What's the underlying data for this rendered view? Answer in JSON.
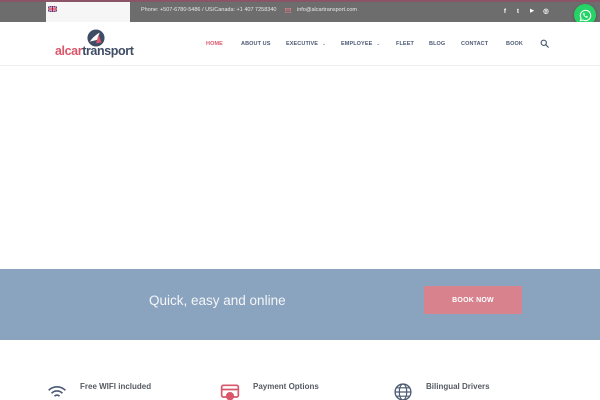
{
  "topbar": {
    "phone": "Phone: +507-6780-5486 / US/Canada: +1 407 7258340",
    "email": "info@alcartransport.com",
    "social": [
      {
        "icon": "facebook-icon",
        "glyph": "f"
      },
      {
        "icon": "twitter-icon",
        "glyph": "t"
      },
      {
        "icon": "youtube-icon",
        "glyph": "▶"
      },
      {
        "icon": "instagram-icon",
        "glyph": "◎"
      }
    ]
  },
  "brand": {
    "part1": "alcar",
    "part2": "transport",
    "accent": "#d9566b",
    "dark": "#3f4c66"
  },
  "nav": {
    "items": [
      {
        "label": "HOME",
        "active": true
      },
      {
        "label": "ABOUT US"
      },
      {
        "label": "EXECUTIVE",
        "has_dropdown": true
      },
      {
        "label": "EMPLOYEE",
        "has_dropdown": true
      },
      {
        "label": "FLEET"
      },
      {
        "label": "BLOG"
      },
      {
        "label": "CONTACT"
      },
      {
        "label": "BOOK"
      }
    ]
  },
  "cta": {
    "text": "Quick, easy and online",
    "button": "BOOK NOW",
    "band_color": "#8aa3be",
    "button_color": "#d8828e"
  },
  "features": [
    {
      "title": "Free WIFI included",
      "icon": "wifi-icon"
    },
    {
      "title": "Payment Options",
      "icon": "credit-card-icon"
    },
    {
      "title": "Bilingual Drivers",
      "icon": "globe-icon"
    }
  ]
}
